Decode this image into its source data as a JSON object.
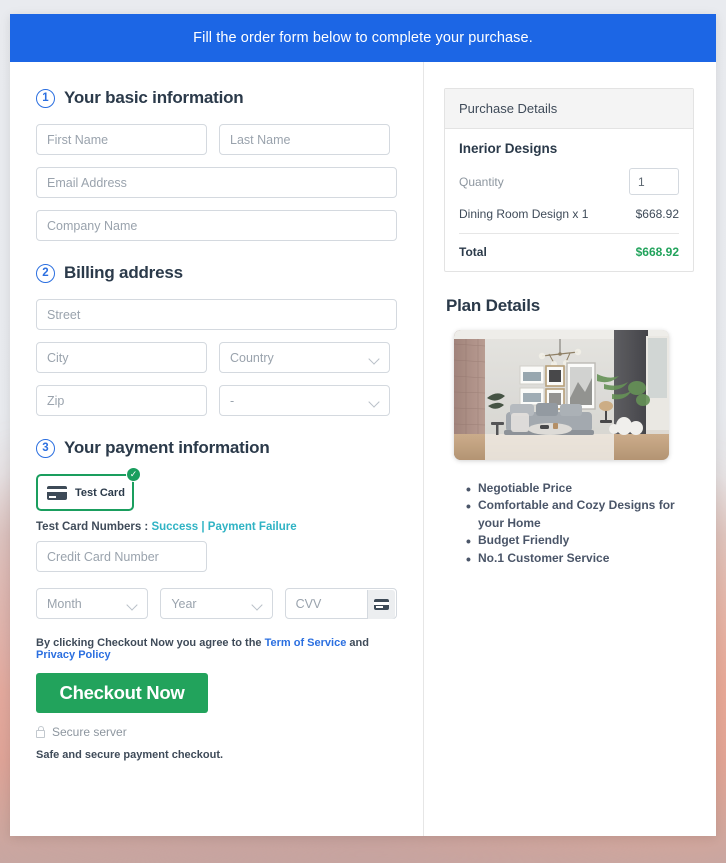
{
  "banner": {
    "text": "Fill the order form below to complete your purchase."
  },
  "steps": {
    "basic": {
      "number": "1",
      "title": "Your basic information",
      "fields": {
        "first_name": "First Name",
        "last_name": "Last Name",
        "email": "Email Address",
        "company": "Company Name"
      }
    },
    "billing": {
      "number": "2",
      "title": "Billing address",
      "fields": {
        "street": "Street",
        "city": "City",
        "country": "Country",
        "zip": "Zip",
        "state": "-"
      }
    },
    "payment": {
      "number": "3",
      "title": "Your payment information",
      "card_tile_label": "Test Card",
      "card_tile_selected": true,
      "testcards_prefix": "Test Card Numbers :",
      "testcards_success": "Success",
      "testcards_separator": "|",
      "testcards_failure": "Payment Failure",
      "fields": {
        "card_number": "Credit Card Number",
        "month": "Month",
        "year": "Year",
        "cvv": "CVV"
      }
    }
  },
  "footer": {
    "terms_prefix": "By clicking Checkout Now you agree to the",
    "terms_link": "Term of Service",
    "terms_and": "and",
    "privacy_link": "Privacy Policy",
    "checkout_label": "Checkout Now",
    "secure_server": "Secure server",
    "safe_note": "Safe and secure payment checkout."
  },
  "purchase": {
    "header": "Purchase Details",
    "product_name": "Inerior Designs",
    "quantity_label": "Quantity",
    "quantity_value": "1",
    "line_item_label": "Dining Room Design x 1",
    "line_item_price": "$668.92",
    "total_label": "Total",
    "total_price": "$668.92"
  },
  "plan": {
    "title": "Plan Details",
    "image_alt": "interior-living-room-photo",
    "bullets": [
      "Negotiable Price",
      "Comfortable and Cozy Designs for your Home",
      "Budget Friendly",
      "No.1 Customer Service"
    ]
  },
  "colors": {
    "banner_blue": "#1c66e5",
    "accent_green": "#22a35c",
    "link_teal": "#2fb3c4",
    "link_blue": "#2b6fe0",
    "heading_navy": "#2b3a4a"
  }
}
